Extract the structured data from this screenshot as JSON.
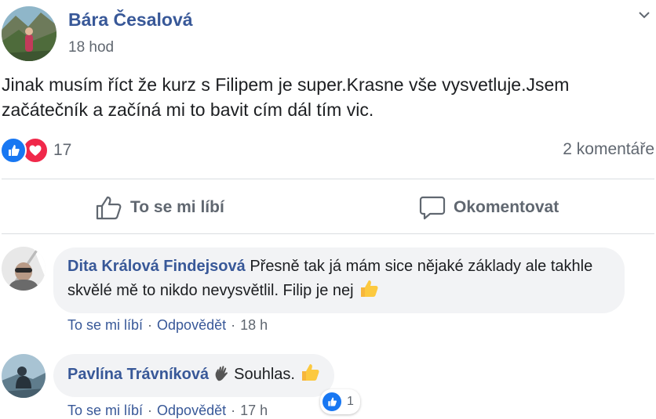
{
  "post": {
    "author": "Bára Česalová",
    "time": "18 hod",
    "text": "Jinak musím říct že kurz s Filipem je super.Krasne vše vysvetluje.Jsem začátečník a začíná mi to bavit cím dál tím vic.",
    "reactions": {
      "count": "17",
      "types": [
        "like-icon",
        "love-icon"
      ]
    },
    "comments_count": "2 komentáře"
  },
  "actions": {
    "like_label": "To se mi líbí",
    "comment_label": "Okomentovat"
  },
  "comments": [
    {
      "author": "Dita Králová Findejsová",
      "text": "Přesně tak já mám sice nějaké základy ale takhle skvělé mě to nikdo nevysvětlil. Filip je nej",
      "like_label": "To se mi líbí",
      "reply_label": "Odpovědět",
      "time": "18 h"
    },
    {
      "author": "Pavlína Trávníková",
      "text": "Souhlas.",
      "like_label": "To se mi líbí",
      "reply_label": "Odpovědět",
      "time": "17 h",
      "reaction_count": "1"
    }
  ],
  "colors": {
    "link": "#385898",
    "secondary_text": "#606770",
    "like_blue": "#1877f2",
    "love_red": "#f0284a",
    "bubble_bg": "#f2f3f5"
  }
}
